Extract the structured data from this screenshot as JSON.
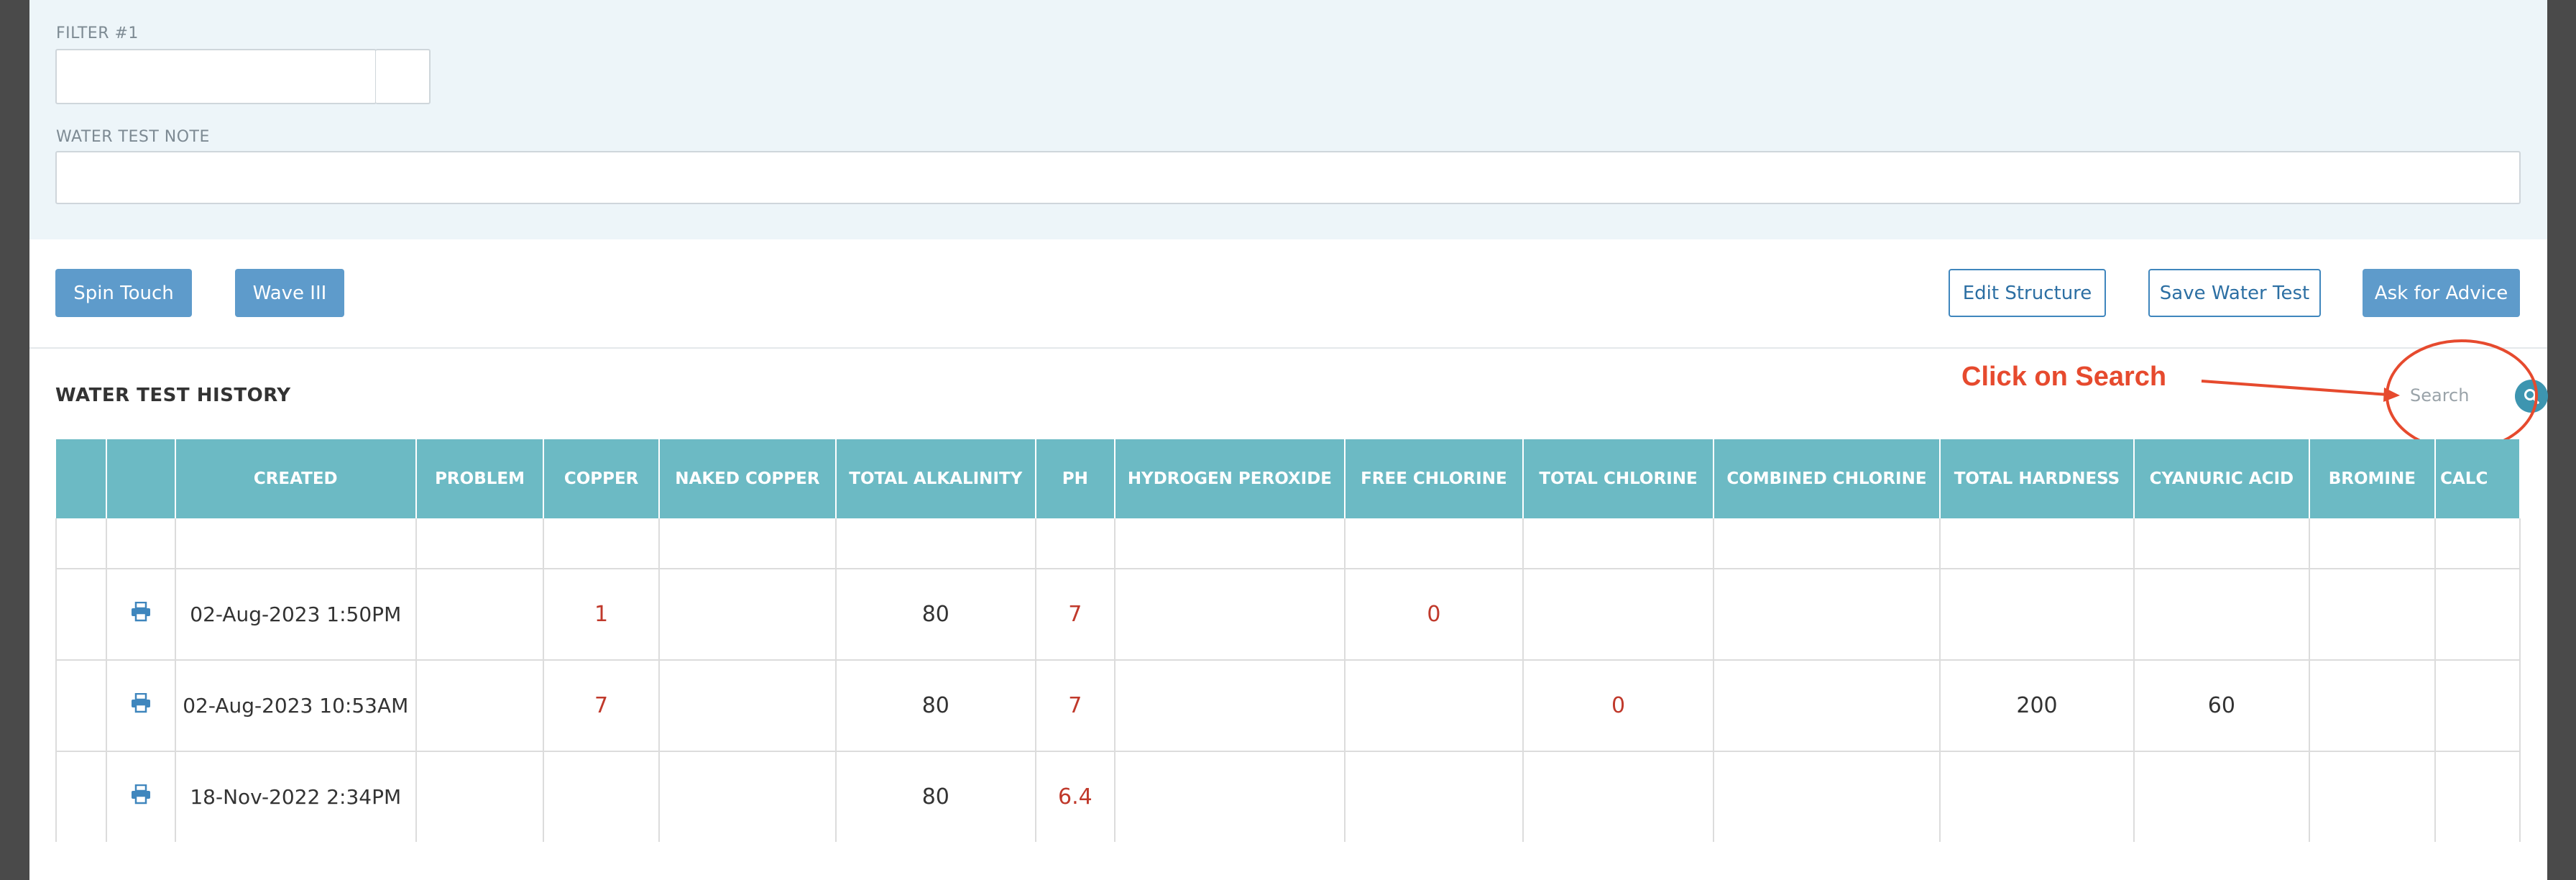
{
  "filters": {
    "filter1_label": "FILTER #1",
    "filter1_value": "",
    "note_label": "WATER TEST NOTE",
    "note_value": ""
  },
  "buttons": {
    "spin_touch": "Spin Touch",
    "wave_iii": "Wave III",
    "edit_structure": "Edit Structure",
    "save_water_test": "Save Water Test",
    "ask_for_advice": "Ask for Advice"
  },
  "history": {
    "title": "WATER TEST HISTORY",
    "search_placeholder": "Search",
    "annotation": "Click on Search"
  },
  "table": {
    "columns": [
      "",
      "",
      "CREATED",
      "PROBLEM",
      "COPPER",
      "NAKED COPPER",
      "TOTAL ALKALINITY",
      "PH",
      "HYDROGEN PEROXIDE",
      "FREE CHLORINE",
      "TOTAL CHLORINE",
      "COMBINED CHLORINE",
      "TOTAL HARDNESS",
      "CYANURIC ACID",
      "BROMINE",
      "CALC"
    ],
    "rows": [
      {
        "created": "02-Aug-2023 1:50PM",
        "problem": "",
        "copper": "1",
        "naked_copper": "",
        "total_alkalinity": "80",
        "ph": "7",
        "hydrogen_peroxide": "",
        "free_chlorine": "0",
        "total_chlorine": "",
        "combined_chlorine": "",
        "total_hardness": "",
        "cyanuric_acid": "",
        "bromine": "",
        "calc": ""
      },
      {
        "created": "02-Aug-2023 10:53AM",
        "problem": "",
        "copper": "7",
        "naked_copper": "",
        "total_alkalinity": "80",
        "ph": "7",
        "hydrogen_peroxide": "",
        "free_chlorine": "",
        "total_chlorine": "0",
        "combined_chlorine": "",
        "total_hardness": "200",
        "cyanuric_acid": "60",
        "bromine": "",
        "calc": ""
      },
      {
        "created": "18-Nov-2022 2:34PM",
        "problem": "",
        "copper": "",
        "naked_copper": "",
        "total_alkalinity": "80",
        "ph": "6.4",
        "hydrogen_peroxide": "",
        "free_chlorine": "",
        "total_chlorine": "",
        "combined_chlorine": "",
        "total_hardness": "",
        "cyanuric_acid": "",
        "bromine": "",
        "calc": ""
      }
    ]
  },
  "icons": {
    "print": "printer-icon",
    "search": "search-icon"
  },
  "colors": {
    "header": "#6cbac4",
    "button": "#5e9bcb",
    "annotation": "#e64a2e",
    "alert_value": "#c0392b"
  }
}
